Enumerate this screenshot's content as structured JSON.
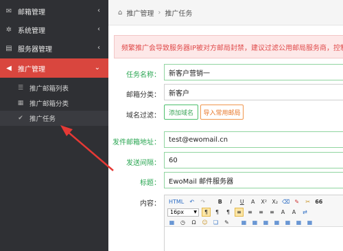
{
  "sidebar": {
    "items": [
      {
        "label": "邮箱管理",
        "icon": "envelope-icon",
        "chevron": "‹"
      },
      {
        "label": "系统管理",
        "icon": "gear-icon",
        "chevron": "‹"
      },
      {
        "label": "服务器管理",
        "icon": "server-icon",
        "chevron": "‹"
      },
      {
        "label": "推广管理",
        "icon": "megaphone-icon",
        "chevron": "⌄"
      }
    ],
    "subitems": [
      {
        "label": "推广邮箱列表",
        "icon": "list-icon"
      },
      {
        "label": "推广邮箱分类",
        "icon": "grid-icon"
      },
      {
        "label": "推广任务",
        "icon": "clipboard-icon"
      }
    ]
  },
  "breadcrumb": {
    "home": "推广管理",
    "current": "推广任务"
  },
  "alert": {
    "text": "频繁推广会导致服务器IP被对方邮局封禁，建议过滤公用邮局服务商，控制好"
  },
  "form": {
    "task_name": {
      "label": "任务名称：",
      "value": "新客户营销一"
    },
    "category": {
      "label": "邮箱分类：",
      "value": "新客户"
    },
    "domain_filter": {
      "label": "域名过滤：",
      "add_button": "添加域名",
      "import_button": "导入常用邮局"
    },
    "sender": {
      "label": "发件邮箱地址：",
      "value": "test@ewomail.cn"
    },
    "interval": {
      "label": "发送间隔：",
      "value": "60"
    },
    "title": {
      "label": "标题：",
      "value": "EwoMail 邮件服务器"
    },
    "content": {
      "label": "内容："
    }
  },
  "editor": {
    "font_size": "16px",
    "toolbar_row1": [
      "HTML",
      "↶",
      "↷",
      "B",
      "I",
      "U",
      "A",
      "X²",
      "X₂",
      "⌫",
      "✎",
      "✂",
      "66"
    ],
    "toolbar_row2_marks": [
      "¶",
      "¶",
      "¶",
      "≡",
      "≡",
      "≡",
      "≡",
      "A",
      "A",
      "⇄"
    ],
    "toolbar_row3": [
      "▦",
      "◷",
      "Ω",
      "☺",
      "❏",
      "✎",
      "▦",
      "▦",
      "▦",
      "▦",
      "▦",
      "▦",
      "▦"
    ]
  },
  "colors": {
    "sidebar_bg": "#2f3034",
    "active_red": "#d9463e",
    "green": "#2aa652",
    "orange": "#e7782b",
    "arrow": "#e53935"
  }
}
